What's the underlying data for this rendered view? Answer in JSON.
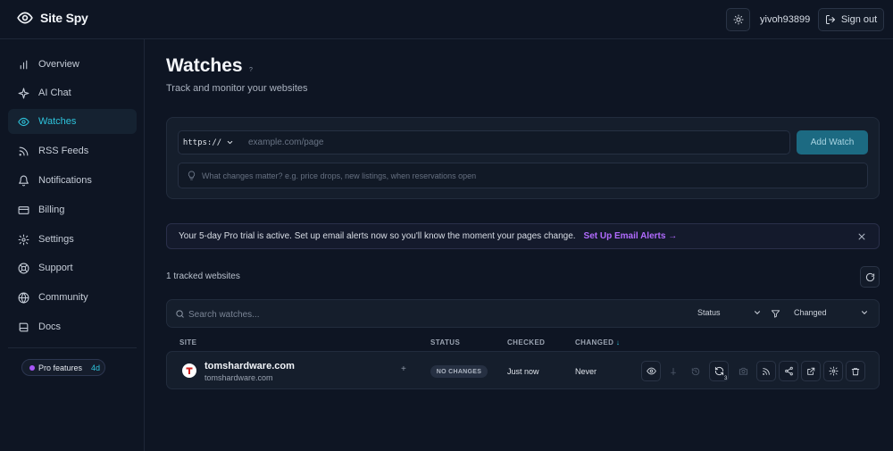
{
  "app": {
    "name": "Site Spy"
  },
  "header": {
    "username": "yivoh93899",
    "signout_label": "Sign out"
  },
  "sidebar": {
    "items": [
      {
        "label": "Overview",
        "icon": "bar-chart-icon"
      },
      {
        "label": "AI Chat",
        "icon": "sparkle-icon"
      },
      {
        "label": "Watches",
        "icon": "eye-icon",
        "active": true
      },
      {
        "label": "RSS Feeds",
        "icon": "rss-icon"
      },
      {
        "label": "Notifications",
        "icon": "bell-icon"
      },
      {
        "label": "Billing",
        "icon": "credit-card-icon"
      },
      {
        "label": "Settings",
        "icon": "gear-icon"
      },
      {
        "label": "Support",
        "icon": "lifebuoy-icon"
      },
      {
        "label": "Community",
        "icon": "globe-icon"
      },
      {
        "label": "Docs",
        "icon": "book-icon"
      }
    ],
    "pro_badge": {
      "label": "Pro features",
      "days": "4d"
    }
  },
  "main": {
    "title": "Watches",
    "title_sup": "?",
    "subtitle": "Track and monitor your websites",
    "add_watch": {
      "protocol": "https://",
      "url_placeholder": "example.com/page",
      "button_label": "Add Watch",
      "changes_placeholder": "What changes matter? e.g. price drops, new listings, when reservations open"
    },
    "banner": {
      "text": "Your 5-day Pro trial is active. Set up email alerts now so you'll know the moment your pages change.",
      "link": "Set Up Email Alerts →"
    },
    "tracked_count": "1 tracked websites",
    "search": {
      "placeholder": "Search watches...",
      "status_filter": "Status",
      "sort_filter": "Changed"
    },
    "table": {
      "headers": {
        "site": "SITE",
        "status": "STATUS",
        "checked": "CHECKED",
        "changed": "CHANGED",
        "sort_arrow": "↓"
      },
      "rows": [
        {
          "name": "tomshardware.com",
          "url": "tomshardware.com",
          "plus": "+",
          "status": "NO CHANGES",
          "checked": "Just now",
          "changed": "Never",
          "sync_count": "3"
        }
      ]
    }
  },
  "colors": {
    "accent": "#2ec4dc",
    "background": "#0e1523",
    "link_purple": "#b26bff"
  }
}
